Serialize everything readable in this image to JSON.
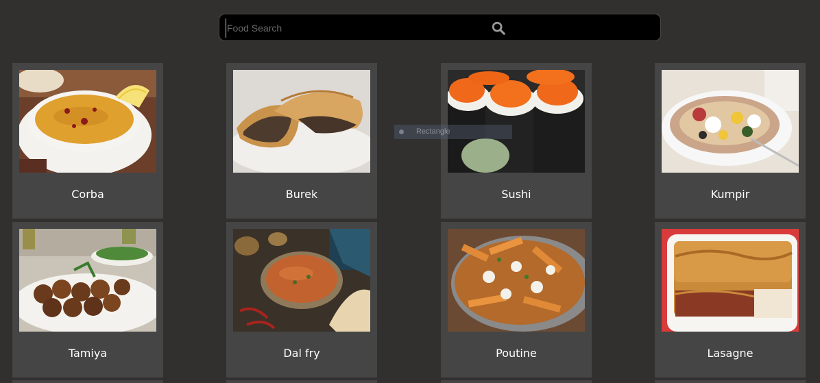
{
  "search": {
    "placeholder": "Food Search",
    "value": ""
  },
  "foods": [
    {
      "name": "Corba"
    },
    {
      "name": "Burek"
    },
    {
      "name": "Sushi"
    },
    {
      "name": "Kumpir"
    },
    {
      "name": "Tamiya"
    },
    {
      "name": "Dal fry"
    },
    {
      "name": "Poutine"
    },
    {
      "name": "Lasagne"
    }
  ],
  "drag_ghost": {
    "label": "Rectangle"
  },
  "colors": {
    "background": "#32302f",
    "card": "#454545",
    "search_background": "#000000",
    "text": "#ffffff"
  },
  "icons": {
    "search": "search-icon"
  }
}
